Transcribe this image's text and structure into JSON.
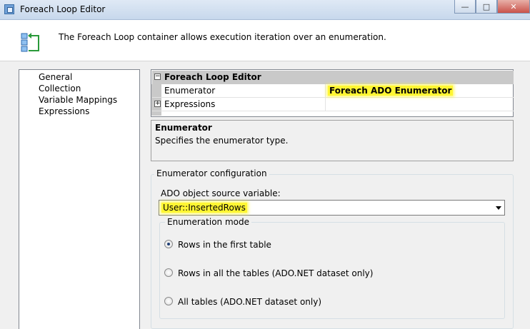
{
  "window": {
    "title": "Foreach Loop Editor",
    "controls": [
      "minimize",
      "maximize",
      "close"
    ]
  },
  "header": {
    "icon": "foreach-loop-container-icon",
    "text": "The Foreach Loop container allows execution iteration over an enumeration."
  },
  "nav": {
    "items": [
      {
        "label": "General"
      },
      {
        "label": "Collection",
        "selected": true
      },
      {
        "label": "Variable Mappings"
      },
      {
        "label": "Expressions"
      }
    ]
  },
  "property_grid": {
    "category": "Foreach Loop Editor",
    "rows": [
      {
        "name": "Enumerator",
        "value": "Foreach ADO Enumerator",
        "highlighted": true
      },
      {
        "name": "Expressions",
        "value": "",
        "expandable": true
      }
    ]
  },
  "description": {
    "title": "Enumerator",
    "text": "Specifies the enumerator type."
  },
  "enumerator_config": {
    "legend": "Enumerator configuration",
    "source_label": "ADO object source variable:",
    "source_value": "User::InsertedRows",
    "mode_legend": "Enumeration mode",
    "options": [
      {
        "label": "Rows in the first table",
        "checked": true
      },
      {
        "label": "Rows in all the tables (ADO.NET dataset only)",
        "checked": false
      },
      {
        "label": "All tables (ADO.NET dataset only)",
        "checked": false
      }
    ]
  },
  "colors": {
    "highlight": "#fff633",
    "category_bg": "#c9c9c9",
    "dialog_bg": "#f0f0f0"
  }
}
